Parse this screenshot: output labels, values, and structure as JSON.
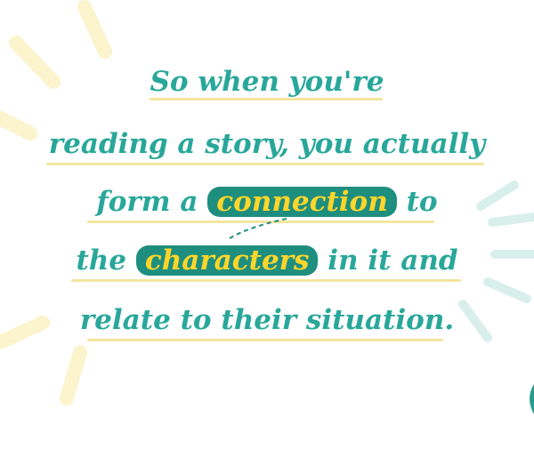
{
  "lines": [
    "So when you're",
    "reading a story, you actually",
    "form a",
    "connection",
    "to",
    "the",
    "characters",
    "in it and",
    "relate to their situation."
  ],
  "colors": {
    "text": "#28a79a",
    "highlight_bg": "#1e8f7e",
    "highlight_text": "#ffd629",
    "underline": "#f3e69e",
    "ray_yellow": "#fbf4cc",
    "ray_teal": "#d8efec"
  }
}
